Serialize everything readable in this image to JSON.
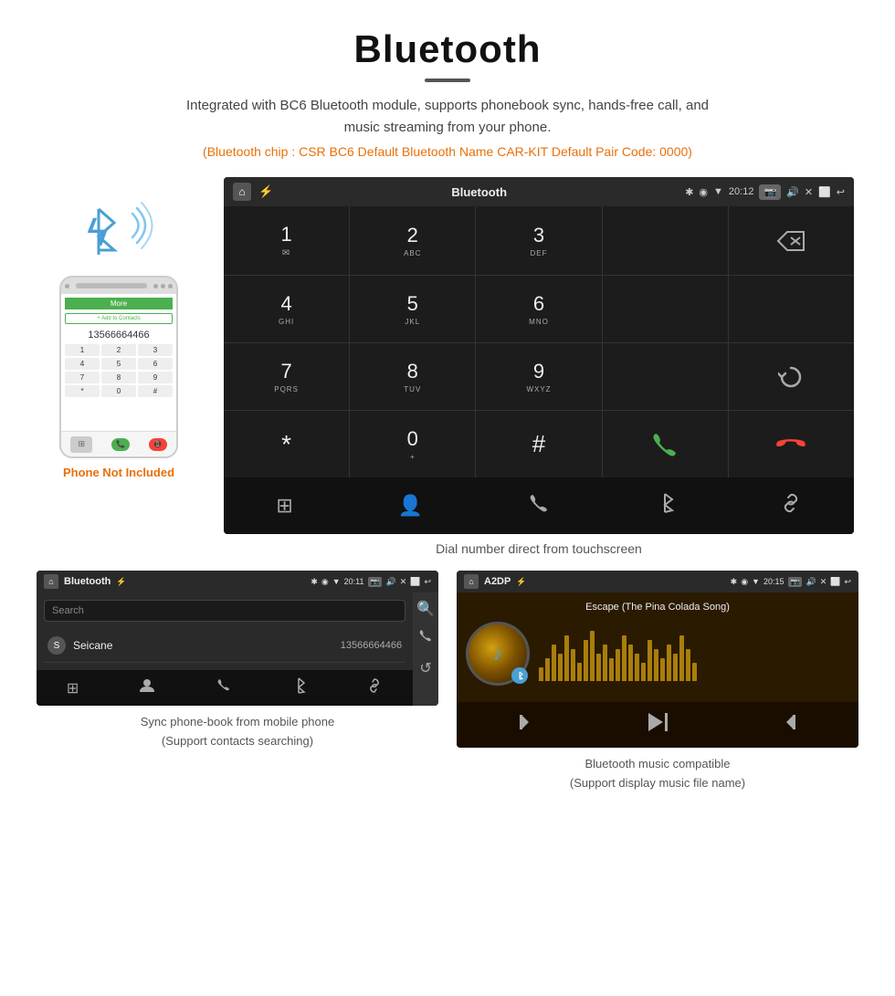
{
  "header": {
    "title": "Bluetooth",
    "description": "Integrated with BC6 Bluetooth module, supports phonebook sync, hands-free call, and music streaming from your phone.",
    "specs": "(Bluetooth chip : CSR BC6    Default Bluetooth Name CAR-KIT    Default Pair Code: 0000)"
  },
  "phone_section": {
    "label": "Phone Not Included"
  },
  "car_screen": {
    "status_bar": {
      "app_name": "Bluetooth",
      "time": "20:12"
    },
    "dialpad": {
      "keys": [
        {
          "digit": "1",
          "sub": ""
        },
        {
          "digit": "2",
          "sub": "ABC"
        },
        {
          "digit": "3",
          "sub": "DEF"
        },
        {
          "digit": "",
          "sub": ""
        },
        {
          "digit": "⌫",
          "sub": ""
        },
        {
          "digit": "4",
          "sub": "GHI"
        },
        {
          "digit": "5",
          "sub": "JKL"
        },
        {
          "digit": "6",
          "sub": "MNO"
        },
        {
          "digit": "",
          "sub": ""
        },
        {
          "digit": "",
          "sub": ""
        },
        {
          "digit": "7",
          "sub": "PQRS"
        },
        {
          "digit": "8",
          "sub": "TUV"
        },
        {
          "digit": "9",
          "sub": "WXYZ"
        },
        {
          "digit": "",
          "sub": ""
        },
        {
          "digit": "↺",
          "sub": ""
        },
        {
          "digit": "*",
          "sub": ""
        },
        {
          "digit": "0",
          "sub": "+"
        },
        {
          "digit": "#",
          "sub": ""
        },
        {
          "digit": "📞",
          "sub": ""
        },
        {
          "digit": "📵",
          "sub": ""
        }
      ]
    },
    "caption": "Dial number direct from touchscreen"
  },
  "phonebook_screen": {
    "status_bar": {
      "app_name": "Bluetooth",
      "time": "20:11"
    },
    "search_placeholder": "Search",
    "contacts": [
      {
        "letter": "S",
        "name": "Seicane",
        "phone": "13566664466"
      }
    ],
    "caption": "Sync phone-book from mobile phone\n(Support contacts searching)"
  },
  "music_screen": {
    "status_bar": {
      "app_name": "A2DP",
      "time": "20:15"
    },
    "song_title": "Escape (The Pina Colada Song)",
    "caption": "Bluetooth music compatible\n(Support display music file name)"
  },
  "icons": {
    "home": "⌂",
    "bluetooth": "⚡",
    "usb": "⚡",
    "camera": "📷",
    "volume": "🔊",
    "back": "↩",
    "keypad": "⊞",
    "person": "👤",
    "phone": "📞",
    "bt": "⚡",
    "link": "🔗",
    "search": "🔍",
    "refresh": "↺",
    "prev": "⏮",
    "playpause": "⏯",
    "next": "⏭"
  }
}
